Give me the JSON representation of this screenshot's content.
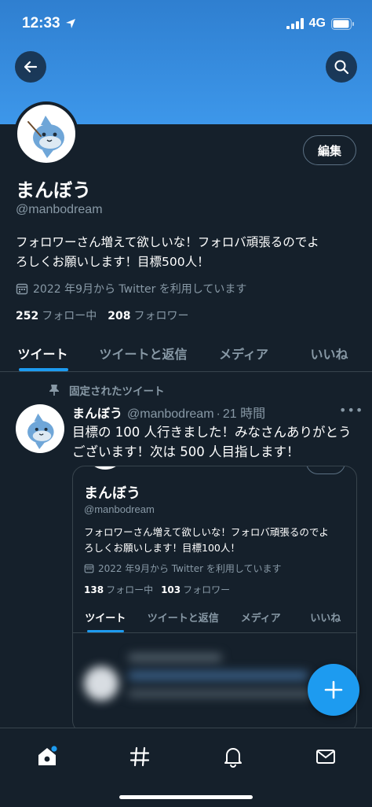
{
  "status": {
    "time": "12:33",
    "network": "4G"
  },
  "profile": {
    "name": "まんぼう",
    "handle": "@manbodream",
    "edit_label": "編集",
    "bio_line1": "フォロワーさん増えて欲しいな！フォロバ頑張るのでよ",
    "bio_line2": "ろしくお願いします！目標500人！",
    "joined": "2022 年9月から Twitter を利用しています",
    "following_count": "252",
    "following_label": "フォロー中",
    "followers_count": "208",
    "followers_label": "フォロワー"
  },
  "tabs": [
    "ツイート",
    "ツイートと返信",
    "メディア",
    "いいね"
  ],
  "pinned_label": "固定されたツイート",
  "tweet": {
    "name": "まんぼう",
    "handle": "@manbodream",
    "sep": "·",
    "time": "21 時間",
    "more": "•••",
    "text_line1": "目標の 100 人行きました！みなさんありがとう",
    "text_line2": "ございます！次は 500 人目指します！"
  },
  "card": {
    "name": "まんぼう",
    "handle": "@manbodream",
    "bio_line1": "フォロワーさん増えて欲しいな！フォロバ頑張るのでよ",
    "bio_line2": "ろしくお願いします！目標100人！",
    "joined": "2022 年9月から Twitter を利用しています",
    "following_count": "138",
    "following_label": "フォロー中",
    "followers_count": "103",
    "followers_label": "フォロワー",
    "tabs": [
      "ツイート",
      "ツイートと返信",
      "メディア",
      "いいね"
    ]
  },
  "icons": {
    "back": "arrow-left-icon",
    "search": "search-icon",
    "compose": "plus-icon",
    "home": "home-icon",
    "explore": "hashtag-icon",
    "notifications": "bell-icon",
    "messages": "envelope-icon"
  },
  "colors": {
    "accent": "#1d9bf0",
    "background": "#15202b",
    "muted": "#8899a6"
  }
}
